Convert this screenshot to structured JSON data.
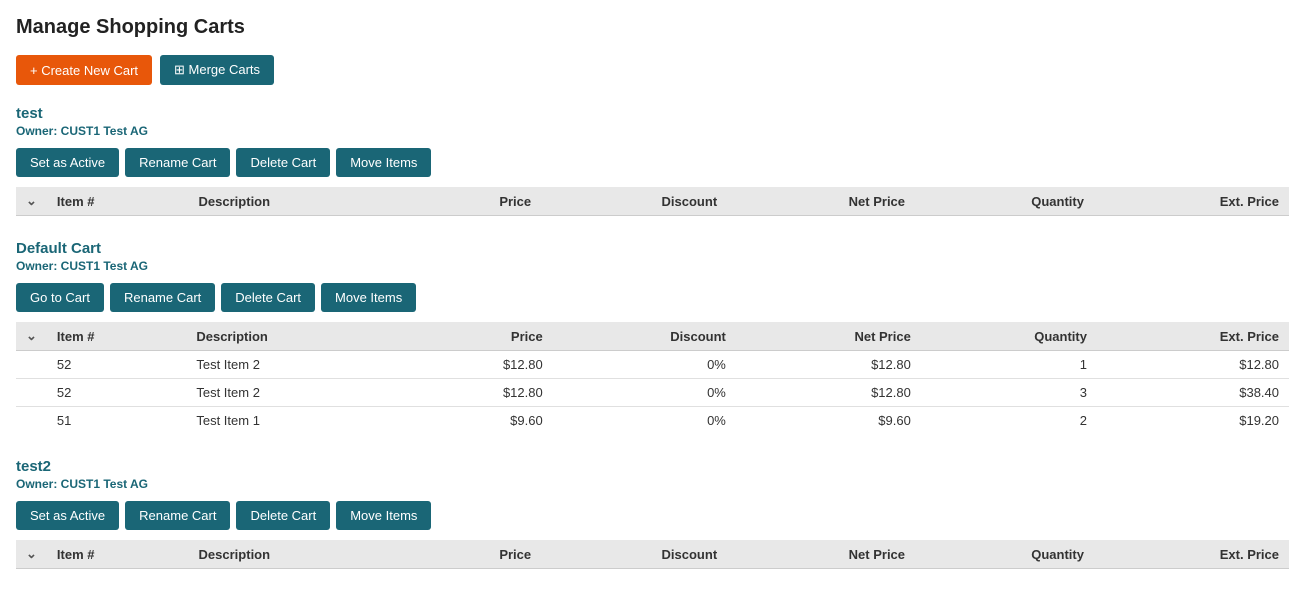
{
  "page": {
    "title": "Manage Shopping Carts"
  },
  "toolbar": {
    "create_label": "+ Create New Cart",
    "merge_label": "⊞ Merge Carts"
  },
  "carts": [
    {
      "id": "test",
      "name": "test",
      "owner": "Owner: CUST1 Test AG",
      "action_primary": "Set as Active",
      "action_primary_icon": "☑",
      "action_rename": "Rename Cart",
      "action_rename_icon": "✎",
      "action_delete": "Delete Cart",
      "action_delete_icon": "🗑",
      "action_move": "Move Items",
      "action_move_icon": "⊞",
      "columns": [
        "Item #",
        "Description",
        "Price",
        "Discount",
        "Net Price",
        "Quantity",
        "Ext. Price"
      ],
      "rows": []
    },
    {
      "id": "default-cart",
      "name": "Default Cart",
      "owner": "Owner: CUST1 Test AG",
      "action_primary": "Go to Cart",
      "action_primary_icon": "⊕",
      "action_rename": "Rename Cart",
      "action_rename_icon": "✎",
      "action_delete": "Delete Cart",
      "action_delete_icon": "🗑",
      "action_move": "Move Items",
      "action_move_icon": "⊞",
      "columns": [
        "Item #",
        "Description",
        "Price",
        "Discount",
        "Net Price",
        "Quantity",
        "Ext. Price"
      ],
      "rows": [
        {
          "item": "52",
          "description": "Test Item 2",
          "price": "$12.80",
          "discount": "0%",
          "net_price": "$12.80",
          "quantity": "1",
          "ext_price": "$12.80"
        },
        {
          "item": "52",
          "description": "Test Item 2",
          "price": "$12.80",
          "discount": "0%",
          "net_price": "$12.80",
          "quantity": "3",
          "ext_price": "$38.40"
        },
        {
          "item": "51",
          "description": "Test Item 1",
          "price": "$9.60",
          "discount": "0%",
          "net_price": "$9.60",
          "quantity": "2",
          "ext_price": "$19.20"
        }
      ]
    },
    {
      "id": "test2",
      "name": "test2",
      "owner": "Owner: CUST1 Test AG",
      "action_primary": "Set as Active",
      "action_primary_icon": "☑",
      "action_rename": "Rename Cart",
      "action_rename_icon": "✎",
      "action_delete": "Delete Cart",
      "action_delete_icon": "🗑",
      "action_move": "Move Items",
      "action_move_icon": "⊞",
      "columns": [
        "Item #",
        "Description",
        "Price",
        "Discount",
        "Net Price",
        "Quantity",
        "Ext. Price"
      ],
      "rows": []
    }
  ]
}
